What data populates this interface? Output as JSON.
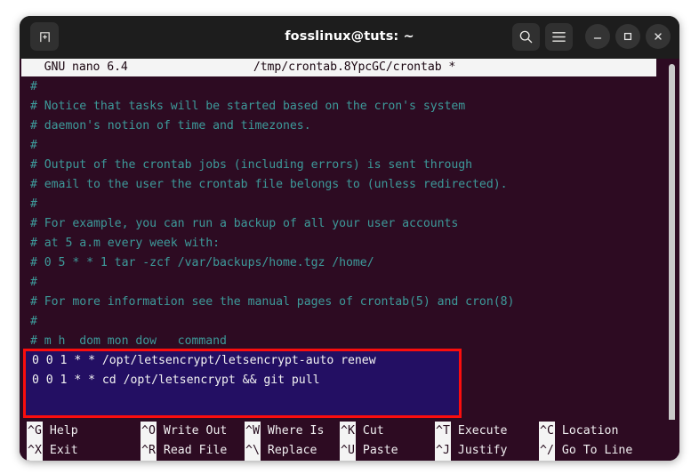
{
  "window": {
    "title": "fosslinux@tuts: ~",
    "new_tab_icon": "new-tab-icon",
    "search_icon": "search-icon",
    "menu_icon": "hamburger-menu-icon",
    "minimize_icon": "minimize-icon",
    "maximize_icon": "maximize-icon",
    "close_icon": "close-icon"
  },
  "editor": {
    "app_title": "GNU nano 6.4",
    "file_path": "/tmp/crontab.8YpcGC/crontab *",
    "header_line": "  GNU nano 6.4                  /tmp/crontab.8YpcGC/crontab *",
    "lines": [
      "#",
      "# Notice that tasks will be started based on the cron's system",
      "# daemon's notion of time and timezones.",
      "#",
      "# Output of the crontab jobs (including errors) is sent through",
      "# email to the user the crontab file belongs to (unless redirected).",
      "#",
      "# For example, you can run a backup of all your user accounts",
      "# at 5 a.m every week with:",
      "# 0 5 * * 1 tar -zcf /var/backups/home.tgz /home/",
      "#",
      "# For more information see the manual pages of crontab(5) and cron(8)",
      "#",
      "# m h  dom mon dow   command"
    ],
    "selected_lines": [
      "0 0 1 * * /opt/letsencrypt/letsencrypt-auto renew",
      "0 0 1 * * cd /opt/letsencrypt && git pull"
    ],
    "colors": {
      "background": "#2d0b22",
      "comment_text": "#3d9a9a",
      "selection_background": "#230f63",
      "selection_text": "#f2f2f2",
      "annotation_border": "#fb0d0d",
      "header_background": "#f4f4f4"
    }
  },
  "shortcuts": [
    {
      "key": "^G",
      "label": "Help",
      "key2": "^X",
      "label2": "Exit"
    },
    {
      "key": "^O",
      "label": "Write Out",
      "key2": "^R",
      "label2": "Read File"
    },
    {
      "key": "^W",
      "label": "Where Is",
      "key2": "^\\",
      "label2": "Replace"
    },
    {
      "key": "^K",
      "label": "Cut",
      "key2": "^U",
      "label2": "Paste"
    },
    {
      "key": "^T",
      "label": "Execute",
      "key2": "^J",
      "label2": "Justify"
    },
    {
      "key": "^C",
      "label": "Location",
      "key2": "^/",
      "label2": "Go To Line"
    }
  ]
}
